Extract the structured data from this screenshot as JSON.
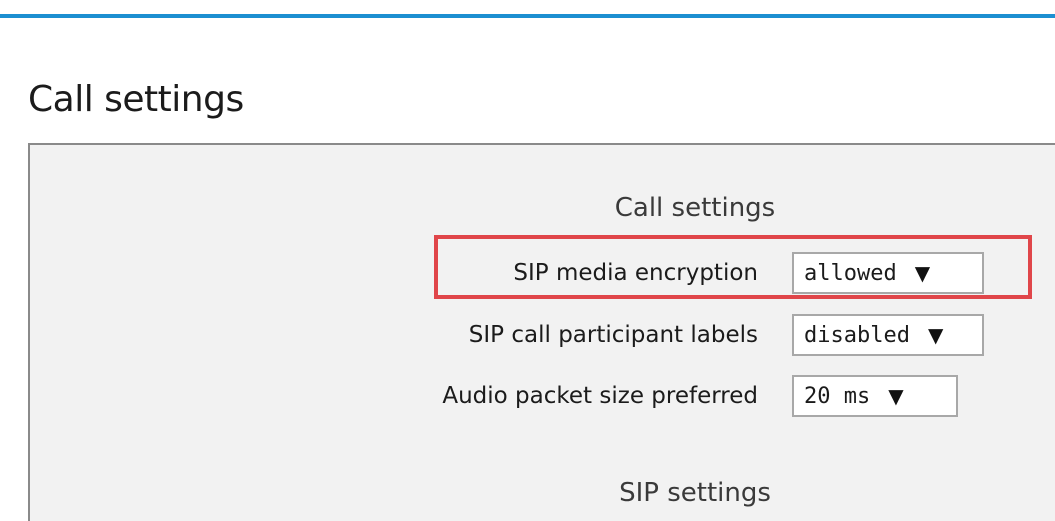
{
  "page": {
    "title": "Call settings",
    "accent_color": "#1c8fd1",
    "highlight_color": "#e0464a"
  },
  "sections": [
    {
      "heading": "Call settings",
      "fields": [
        {
          "label": "SIP media encryption",
          "value": "allowed",
          "highlighted": true
        },
        {
          "label": "SIP call participant labels",
          "value": "disabled",
          "highlighted": false
        },
        {
          "label": "Audio packet size preferred",
          "value": "20 ms",
          "highlighted": false
        }
      ]
    },
    {
      "heading": "SIP settings",
      "fields": []
    }
  ],
  "icons": {
    "dropdown": "chevron-down-icon",
    "dropdown_glyph": "▼"
  }
}
